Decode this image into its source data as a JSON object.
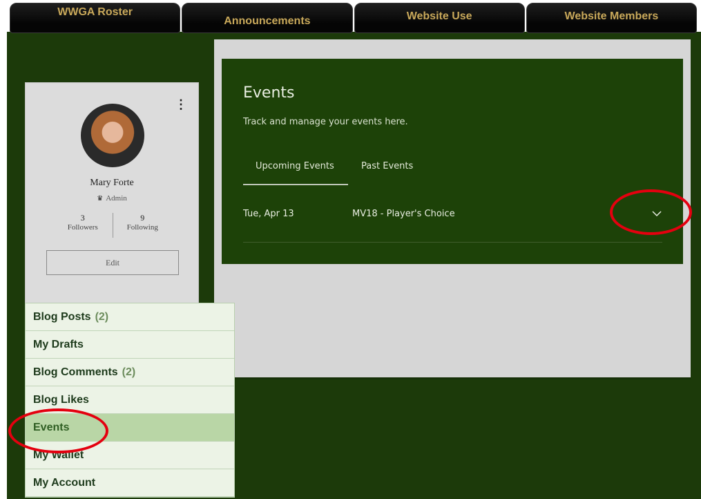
{
  "topnav": {
    "items": [
      "WWGA Roster",
      "Announcements",
      "Website Use",
      "Website Members"
    ]
  },
  "profile": {
    "name": "Mary Forte",
    "role": "Admin",
    "followers_count": "3",
    "followers_label": "Followers",
    "following_count": "9",
    "following_label": "Following",
    "edit_label": "Edit"
  },
  "sidemenu": {
    "items": [
      {
        "label": "Blog Posts",
        "count": "(2)"
      },
      {
        "label": "My Drafts"
      },
      {
        "label": "Blog Comments",
        "count": "(2)"
      },
      {
        "label": "Blog Likes"
      },
      {
        "label": "Events",
        "active": true
      },
      {
        "label": "My Wallet"
      },
      {
        "label": "My Account"
      }
    ]
  },
  "events": {
    "title": "Events",
    "subtitle": "Track and manage your events here.",
    "tabs": [
      "Upcoming Events",
      "Past Events"
    ],
    "active_tab": "Upcoming Events",
    "list": [
      {
        "date": "Tue, Apr 13",
        "name": "MV18 - Player's Choice"
      }
    ]
  },
  "colors": {
    "page_green": "#1c3a0a",
    "panel_green": "#1d4208",
    "nav_gold": "#c8a85a",
    "annotation_red": "#e4000f",
    "menu_active": "#b9d6a6"
  }
}
